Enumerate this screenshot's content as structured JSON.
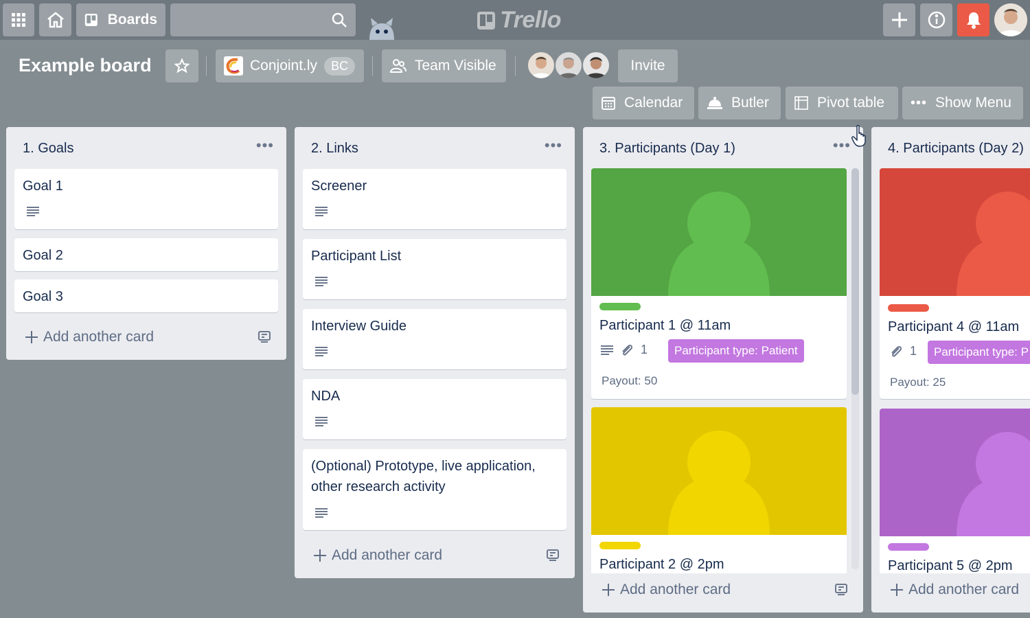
{
  "header": {
    "boards_label": "Boards",
    "logo_text": "Trello",
    "icons": [
      "apps-grid-icon",
      "home-icon",
      "boards-icon",
      "search-icon",
      "plus-icon",
      "info-icon",
      "bell-icon"
    ]
  },
  "board": {
    "title": "Example board",
    "workspace": "Conjoint.ly",
    "workspace_badge": "BC",
    "visibility": "Team Visible",
    "invite_label": "Invite"
  },
  "toolbar": {
    "calendar": "Calendar",
    "butler": "Butler",
    "pivot": "Pivot table",
    "menu": "Show Menu"
  },
  "colors": {
    "board_bg": "#838c91",
    "green": "#61bd4f",
    "yellow": "#f2d600",
    "red": "#eb5a46",
    "purple": "#c377e0",
    "notification": "#eb5a46"
  },
  "add_card_label": "Add another card",
  "lists": [
    {
      "title": "1. Goals",
      "cards": [
        "Goal 1",
        "Goal 2",
        "Goal 3"
      ]
    },
    {
      "title": "2. Links",
      "cards": [
        "Screener",
        "Participant List",
        "Interview Guide",
        "NDA",
        "(Optional) Prototype, live application, other research activity"
      ]
    },
    {
      "title": "3. Participants (Day 1)",
      "cards": [
        {
          "title": "Participant 1 @ 11am",
          "label_color": "green",
          "attachments": "1",
          "field": "Participant type: Patient",
          "payout": "Payout: 50"
        },
        {
          "title": "Participant 2 @ 2pm",
          "label_color": "yellow"
        }
      ]
    },
    {
      "title": "4. Participants (Day 2)",
      "cards": [
        {
          "title": "Participant 4 @ 11am",
          "label_color": "red",
          "attachments": "1",
          "field": "Participant type: P",
          "payout": "Payout: 25"
        },
        {
          "title": "Participant 5 @ 2pm",
          "label_color": "purple"
        }
      ]
    }
  ]
}
